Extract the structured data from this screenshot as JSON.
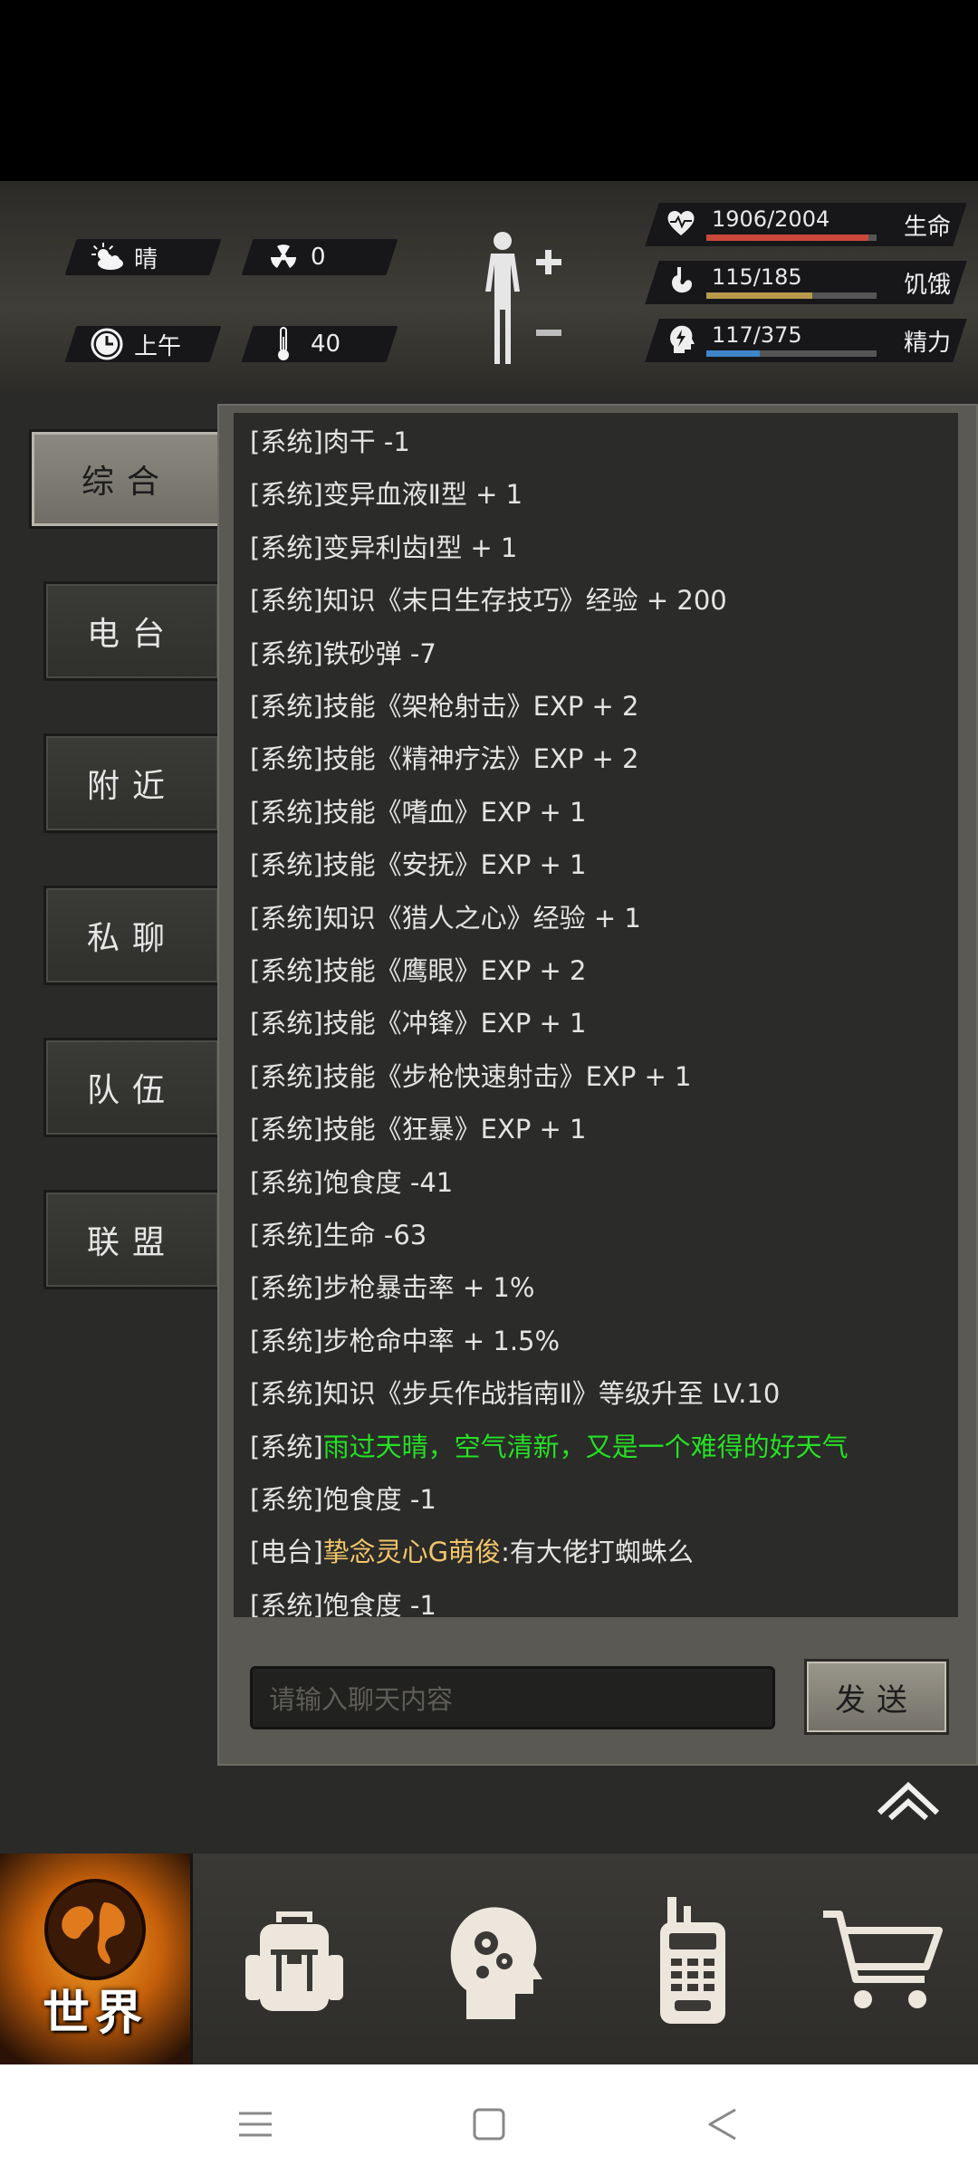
{
  "status": {
    "weather": "晴",
    "radiation": "0",
    "time_of_day": "上午",
    "temperature": "40",
    "health": {
      "value": "1906/2004",
      "label": "生命",
      "fraction": 0.951,
      "color": "#c9483a"
    },
    "hunger": {
      "value": "115/185",
      "label": "饥饿",
      "fraction": 0.622,
      "color": "#b89a4a"
    },
    "energy": {
      "value": "117/375",
      "label": "精力",
      "fraction": 0.312,
      "color": "#3f86c9"
    }
  },
  "sidebar": {
    "tabs": [
      "综合",
      "电台",
      "附近",
      "私聊",
      "队伍",
      "联盟"
    ],
    "active": "综合"
  },
  "chat": {
    "messages": [
      {
        "tag": "[系统]",
        "text": "肉干 -1",
        "style": "normal"
      },
      {
        "tag": "[系统]",
        "text": "变异血液Ⅱ型 + 1",
        "style": "normal"
      },
      {
        "tag": "[系统]",
        "text": "变异利齿Ⅰ型 + 1",
        "style": "normal"
      },
      {
        "tag": "[系统]",
        "text": "知识《末日生存技巧》经验 + 200",
        "style": "normal"
      },
      {
        "tag": "[系统]",
        "text": "铁砂弹 -7",
        "style": "normal"
      },
      {
        "tag": "[系统]",
        "text": "技能《架枪射击》EXP + 2",
        "style": "normal"
      },
      {
        "tag": "[系统]",
        "text": "技能《精神疗法》EXP + 2",
        "style": "normal"
      },
      {
        "tag": "[系统]",
        "text": "技能《嗜血》EXP + 1",
        "style": "normal"
      },
      {
        "tag": "[系统]",
        "text": "技能《安抚》EXP + 1",
        "style": "normal"
      },
      {
        "tag": "[系统]",
        "text": "知识《猎人之心》经验 + 1",
        "style": "normal"
      },
      {
        "tag": "[系统]",
        "text": "技能《鹰眼》EXP + 2",
        "style": "normal"
      },
      {
        "tag": "[系统]",
        "text": "技能《冲锋》EXP + 1",
        "style": "normal"
      },
      {
        "tag": "[系统]",
        "text": "技能《步枪快速射击》EXP + 1",
        "style": "normal"
      },
      {
        "tag": "[系统]",
        "text": "技能《狂暴》EXP + 1",
        "style": "normal"
      },
      {
        "tag": "[系统]",
        "text": "饱食度 -41",
        "style": "normal"
      },
      {
        "tag": "[系统]",
        "text": "生命 -63",
        "style": "normal"
      },
      {
        "tag": "[系统]",
        "text": "步枪暴击率 + 1%",
        "style": "normal"
      },
      {
        "tag": "[系统]",
        "text": "步枪命中率 + 1.5%",
        "style": "normal"
      },
      {
        "tag": "[系统]",
        "text": "知识《步兵作战指南Ⅱ》等级升至 LV.10",
        "style": "normal"
      },
      {
        "tag": "[系统]",
        "text": "雨过天晴，空气清新，又是一个难得的好天气",
        "style": "green"
      },
      {
        "tag": "[系统]",
        "text": "饱食度 -1",
        "style": "normal"
      },
      {
        "tag": "[电台]",
        "sender": "挚念灵心G萌俊",
        "text": ":有大佬打蜘蛛么",
        "style": "radio"
      },
      {
        "tag": "[系统]",
        "text": "饱食度 -1",
        "style": "normal"
      }
    ],
    "input_placeholder": "请输入聊天内容",
    "send_label": "发送"
  },
  "bottom_nav": {
    "world_label": "世界",
    "items": [
      "backpack-icon",
      "skills-head-icon",
      "walkie-talkie-icon",
      "shopping-cart-icon"
    ]
  },
  "colors": {
    "green_message": "#25e025",
    "radio_sender": "#f2c56a",
    "world_glow": "#e8891a"
  }
}
